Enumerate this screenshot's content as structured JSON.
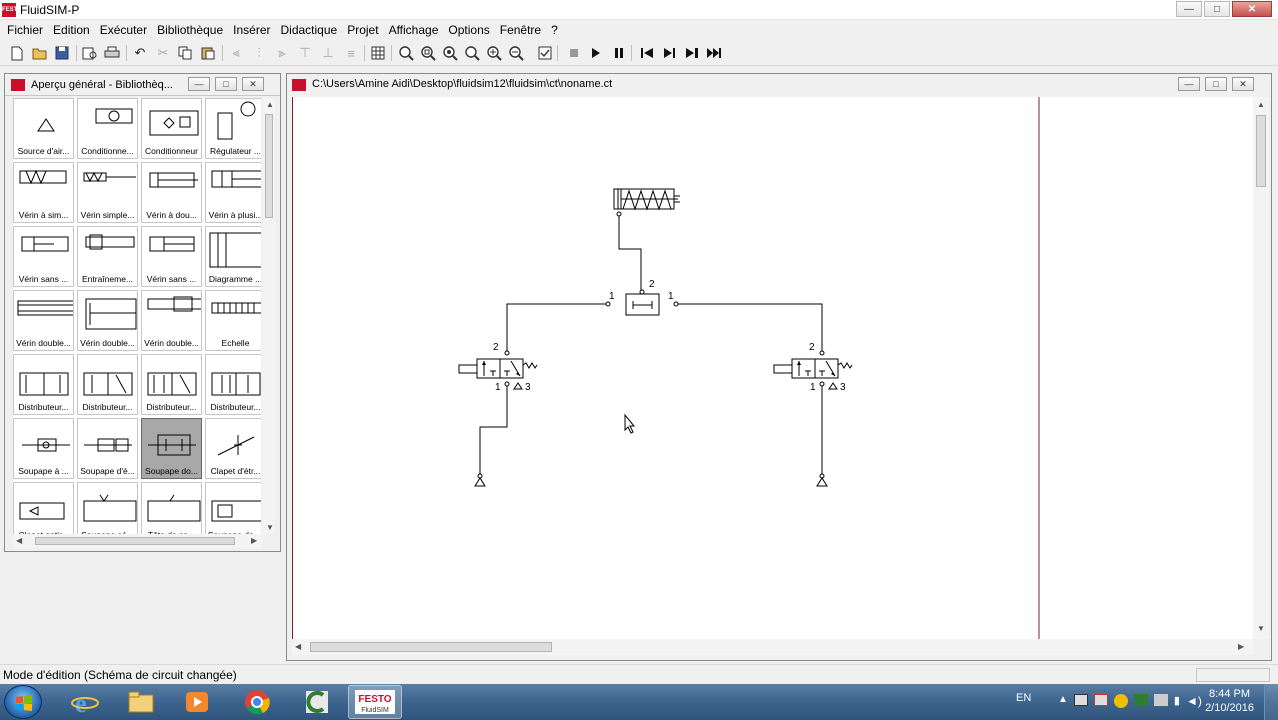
{
  "app": {
    "title": "FluidSIM-P",
    "logo_text": "FESTO"
  },
  "window_controls": {
    "minimize": "—",
    "maximize": "□",
    "close": "✕"
  },
  "menu": [
    "Fichier",
    "Edition",
    "Exécuter",
    "Bibliothèque",
    "Insérer",
    "Didactique",
    "Projet",
    "Affichage",
    "Options",
    "Fenêtre",
    "?"
  ],
  "toolbar": {
    "icons": [
      "new-icon",
      "open-icon",
      "save-icon",
      "print-preview-icon",
      "print-icon",
      "undo-icon",
      "cut-icon",
      "copy-icon",
      "paste-icon",
      "align-left-icon",
      "align-center-icon",
      "align-right-icon",
      "grid-icon",
      "zoom-fit-icon",
      "zoom-window-icon",
      "zoom-previous-icon",
      "zoom-in-icon",
      "zoom-out-icon",
      "check-icon",
      "stop-icon",
      "play-icon",
      "pause-icon",
      "skip-start-icon",
      "step-icon",
      "skip-next-icon",
      "skip-end-icon"
    ]
  },
  "library": {
    "title": "Aperçu général - Bibliothèq...",
    "items": [
      "Source d'air...",
      "Conditionne...",
      "Conditionneur",
      "Régulateur ...",
      "Vérin à sim...",
      "Vérin simple...",
      "Vérin à dou...",
      "Vérin à plusi...",
      "Vérin sans ...",
      "Entraîneme...",
      "Vérin sans ...",
      "Diagramme ...",
      "Vérin double...",
      "Vérin double...",
      "Vérin double...",
      "Echelle",
      "Distributeur...",
      "Distributeur...",
      "Distributeur...",
      "Distributeur...",
      "Soupape à ...",
      "Soupape d'é...",
      "Soupape do...",
      "Clapet d'étr...",
      "Clapet antir...",
      "Soupape sé...",
      "Tête de co...",
      "Soupape de ..."
    ],
    "selected_index": 22
  },
  "document": {
    "title": "C:\\Users\\Amine Aidi\\Desktop\\fluidsim12\\fluidsim\\ct\\noname.ct",
    "port_labels": {
      "shuttle_out": "2",
      "shuttle_in_left": "1",
      "shuttle_in_right": "1",
      "left_valve_out": "2",
      "left_valve_in": "1",
      "left_valve_exhaust": "3",
      "right_valve_out": "2",
      "right_valve_in": "1",
      "right_valve_exhaust": "3"
    }
  },
  "status": {
    "text": "Mode d'édition (Schéma de circuit changée)"
  },
  "taskbar": {
    "apps": [
      "internet-explorer",
      "file-explorer",
      "media-player",
      "chrome",
      "camtasia",
      "fluidsim"
    ],
    "active_app": "fluidsim",
    "fluidsim_label": "FESTO",
    "fluidsim_sub": "FluidSIM",
    "lang": "EN",
    "time": "8:44 PM",
    "date": "2/10/2016"
  }
}
